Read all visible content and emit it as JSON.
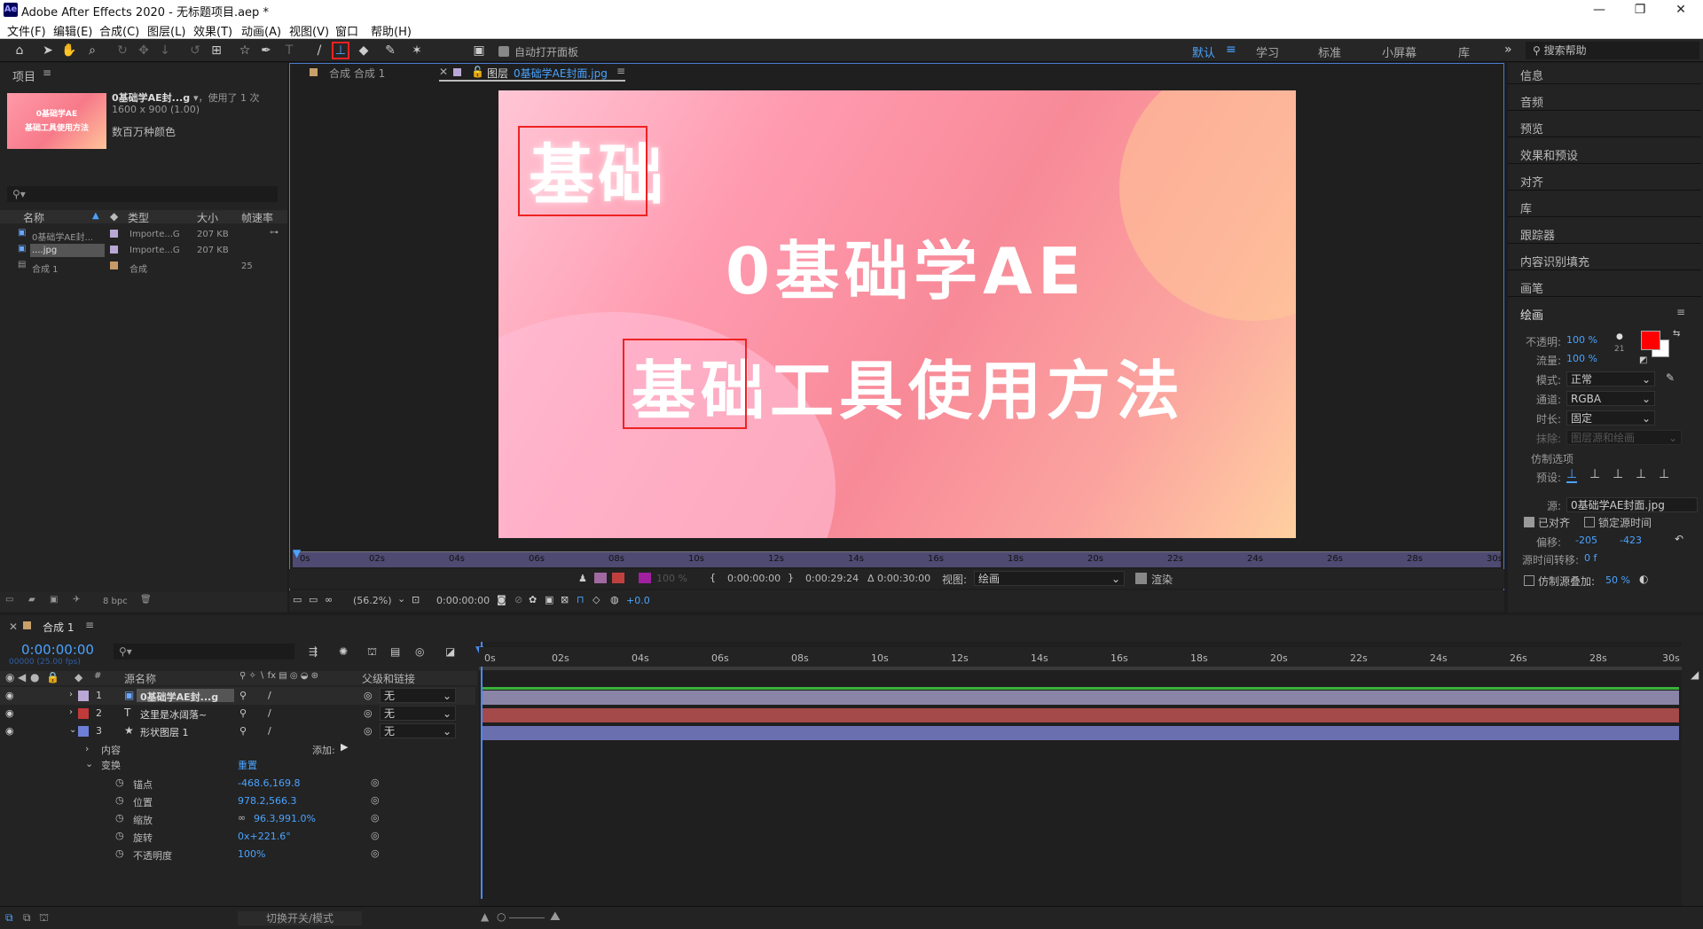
{
  "title_bar": {
    "logo": "Ae",
    "title": "Adobe After Effects 2020 - 无标题项目.aep *",
    "min": "—",
    "max": "❐",
    "close": "✕"
  },
  "menu": [
    "文件(F)",
    "编辑(E)",
    "合成(C)",
    "图层(L)",
    "效果(T)",
    "动画(A)",
    "视图(V)",
    "窗口",
    "帮助(H)"
  ],
  "toolbar": {
    "auto_open": "自动打开面板",
    "workspaces": [
      "默认",
      "学习",
      "标准",
      "小屏幕",
      "库"
    ],
    "active_workspace": "默认",
    "search_help": "搜索帮助"
  },
  "project": {
    "tab": "项目",
    "file_name": "0基础学AE封...g",
    "used": "，使用了 1 次",
    "dims": "1600 x 900 (1.00)",
    "colors": "数百万种颜色",
    "thumb_line1": "0基础学AE",
    "thumb_line2": "基础工具使用方法",
    "columns": [
      "名称",
      "类型",
      "大小",
      "帧速率"
    ],
    "rows": [
      {
        "name": "0基础学AE封...",
        "type": "Importe...G",
        "size": "207 KB",
        "fps": ""
      },
      {
        "name": "....jpg",
        "type": "Importe...G",
        "size": "207 KB",
        "fps": ""
      },
      {
        "name": "合成 1",
        "type": "合成",
        "size": "",
        "fps": "25"
      }
    ],
    "bpc": "8 bpc"
  },
  "viewer": {
    "tab_comp": "合成 合成 1",
    "tab_layer_prefix": "图层",
    "tab_layer_name": "0基础学AE封面.jpg",
    "canvas_t1": "基础",
    "canvas_t2": "0基础学AE",
    "canvas_t3": "基础工具使用方法",
    "ruler": [
      "0s",
      "02s",
      "04s",
      "06s",
      "08s",
      "10s",
      "12s",
      "14s",
      "16s",
      "18s",
      "20s",
      "22s",
      "24s",
      "26s",
      "28s",
      "30s"
    ],
    "in_time": "0:00:00:00",
    "out_time": "0:00:29:24",
    "duration": "Δ 0:00:30:00",
    "opacity_pct": "100 %",
    "view_label": "视图:",
    "view_value": "绘画",
    "render_label": "渲染",
    "zoom": "(56.2%)",
    "current_time": "0:00:00:00",
    "exposure": "+0.0"
  },
  "right_panel": {
    "items": [
      "信息",
      "音频",
      "预览",
      "效果和预设",
      "对齐",
      "库",
      "跟踪器",
      "内容识别填充",
      "画笔"
    ],
    "paint_title": "绘画",
    "opacity_label": "不透明:",
    "opacity_val": "100 %",
    "flow_label": "流量:",
    "flow_val": "100 %",
    "brush_size": "21",
    "mode_label": "模式:",
    "mode_val": "正常",
    "channel_label": "通道:",
    "channel_val": "RGBA",
    "duration_label": "时长:",
    "duration_val": "固定",
    "erase_label": "抹除:",
    "erase_val": "图层源和绘画",
    "clone_title": "仿制选项",
    "preset_label": "预设:",
    "source_label": "源:",
    "source_val": "0基础学AE封面.jpg",
    "aligned": "已对齐",
    "lock_time": "锁定源时间",
    "offset_label": "偏移:",
    "offset_x": "-205",
    "offset_y": "-423",
    "time_shift_label": "源时间转移:",
    "time_shift_val": "0 f",
    "overlay_label": "仿制源叠加:",
    "overlay_val": "50 %",
    "fg_color": "#ff0000",
    "bg_color": "#ffffff"
  },
  "timeline": {
    "tab": "合成 1",
    "time": "0:00:00:00",
    "frames": "00000 (25.00 fps)",
    "col_src": "源名称",
    "col_parent": "父级和链接",
    "ruler": [
      "0s",
      "02s",
      "04s",
      "06s",
      "08s",
      "10s",
      "12s",
      "14s",
      "16s",
      "18s",
      "20s",
      "22s",
      "24s",
      "26s",
      "28s",
      "30s"
    ],
    "layers": [
      {
        "num": "1",
        "name": "0基础学AE封...g",
        "parent": "无",
        "label": "#b9a8d6",
        "bar": "#8a84a6"
      },
      {
        "num": "2",
        "name": "这里是冰阔落~",
        "parent": "无",
        "label": "#c03a3a",
        "bar": "#a44a4a"
      },
      {
        "num": "3",
        "name": "形状图层 1",
        "parent": "无",
        "label": "#6d7fd6",
        "bar": "#6a6fb0"
      }
    ],
    "contents": "内容",
    "add": "添加:",
    "transform": "变换",
    "reset": "重置",
    "props": [
      {
        "name": "锚点",
        "value": "-468.6,169.8"
      },
      {
        "name": "位置",
        "value": "978.2,566.3"
      },
      {
        "name": "缩放",
        "value": "96.3,991.0%"
      },
      {
        "name": "旋转",
        "value": "0x+221.6°"
      },
      {
        "name": "不透明度",
        "value": "100%"
      }
    ],
    "switch_modes": "切换开关/模式"
  }
}
